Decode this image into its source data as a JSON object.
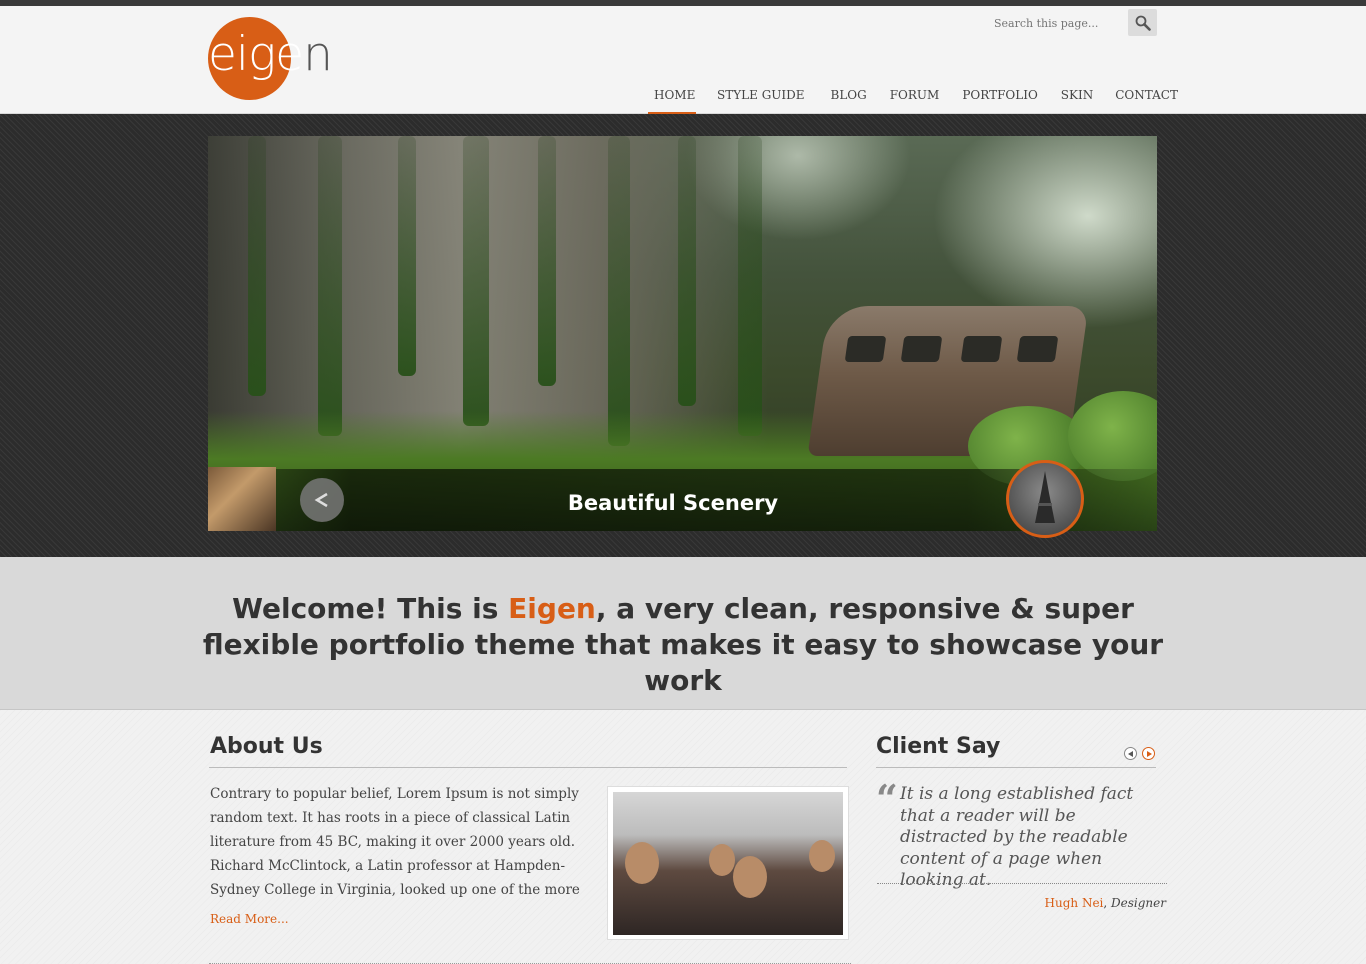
{
  "logo": {
    "text_main": "eige",
    "text_tail": "n"
  },
  "search": {
    "placeholder": "Search this page..."
  },
  "nav": [
    {
      "label": "HOME",
      "active": true
    },
    {
      "label": "STYLE GUIDE",
      "active": false
    },
    {
      "label": "BLOG",
      "active": false
    },
    {
      "label": "FORUM",
      "active": false
    },
    {
      "label": "PORTFOLIO",
      "active": false
    },
    {
      "label": "SKIN",
      "active": false
    },
    {
      "label": "CONTACT",
      "active": false
    }
  ],
  "slider": {
    "caption": "Beautiful Scenery"
  },
  "welcome": {
    "prefix": "Welcome! This is ",
    "brand": "Eigen",
    "suffix": ", a very clean, responsive & super flexible portfolio theme that makes it easy to showcase your work"
  },
  "about": {
    "title": "About Us",
    "body": "Contrary to popular belief, Lorem Ipsum is not simply random text. It has roots in a piece of classical Latin literature from 45 BC, making it over 2000 years old. Richard McClintock, a Latin professor at Hampden-Sydney College in Virginia, looked up one of the more",
    "read_more": "Read More..."
  },
  "client_say": {
    "title": "Client Say",
    "quote": "It is a long established fact that a reader will be distracted by the readable content of a page when looking at.",
    "author_name": "Hugh Nei",
    "author_sep": ", ",
    "author_role": "Designer"
  },
  "colors": {
    "accent": "#d85e16",
    "text": "#333333",
    "topbar": "#3a3a3a"
  }
}
